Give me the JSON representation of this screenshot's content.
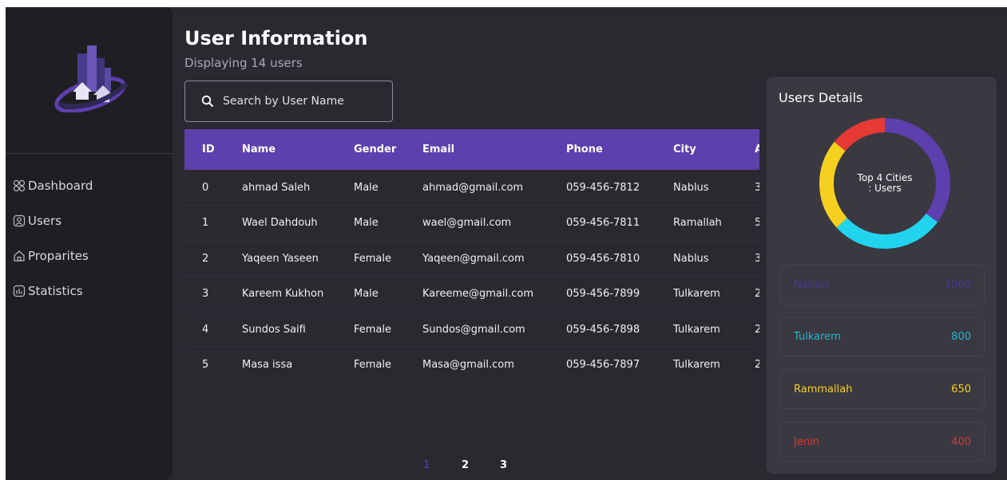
{
  "sidebar": {
    "items": [
      {
        "label": "Dashboard",
        "icon": "dashboard-icon"
      },
      {
        "label": "Users",
        "icon": "users-icon"
      },
      {
        "label": "Proparites",
        "icon": "home-icon"
      },
      {
        "label": "Statistics",
        "icon": "chart-icon"
      }
    ]
  },
  "header": {
    "title": "User Information",
    "subtitle": "Displaying 14 users"
  },
  "search": {
    "placeholder": "Search by User Name"
  },
  "table": {
    "columns": [
      "ID",
      "Name",
      "Gender",
      "Email",
      "Phone",
      "City",
      "A"
    ],
    "rows": [
      [
        "0",
        "ahmad Saleh",
        "Male",
        "ahmad@gmail.com",
        "059-456-7812",
        "Nablus",
        "3"
      ],
      [
        "1",
        "Wael Dahdouh",
        "Male",
        "wael@gmail.com",
        "059-456-7811",
        "Ramallah",
        "5"
      ],
      [
        "2",
        "Yaqeen Yaseen",
        "Female",
        "Yaqeen@gmail.com",
        "059-456-7810",
        "Nablus",
        "3"
      ],
      [
        "3",
        "Kareem Kukhon",
        "Male",
        "Kareeme@gmail.com",
        "059-456-7899",
        "Tulkarem",
        "2"
      ],
      [
        "4",
        "Sundos Saifi",
        "Female",
        "Sundos@gmail.com",
        "059-456-7898",
        "Tulkarem",
        "2"
      ],
      [
        "5",
        "Masa issa",
        "Female",
        "Masa@gmail.com",
        "059-456-7897",
        "Tulkarem",
        "2"
      ]
    ]
  },
  "pagination": {
    "pages": [
      "1",
      "2",
      "3"
    ],
    "current": "1"
  },
  "details": {
    "title": "Users Details",
    "donut_label": "Top 4 Cities : Users",
    "cities": [
      {
        "name": "Nablus",
        "value": "1000",
        "color": "#5d3fad"
      },
      {
        "name": "Tulkarem",
        "value": "800",
        "color": "#22d3ee"
      },
      {
        "name": "Rammallah",
        "value": "650",
        "color": "#f5d020"
      },
      {
        "name": "Jenin",
        "value": "400",
        "color": "#e53935"
      }
    ]
  },
  "colors": {
    "accent": "#5d3fad",
    "background": "#2b2930",
    "sidebar": "#1f1e23",
    "panel": "#3a3840"
  }
}
